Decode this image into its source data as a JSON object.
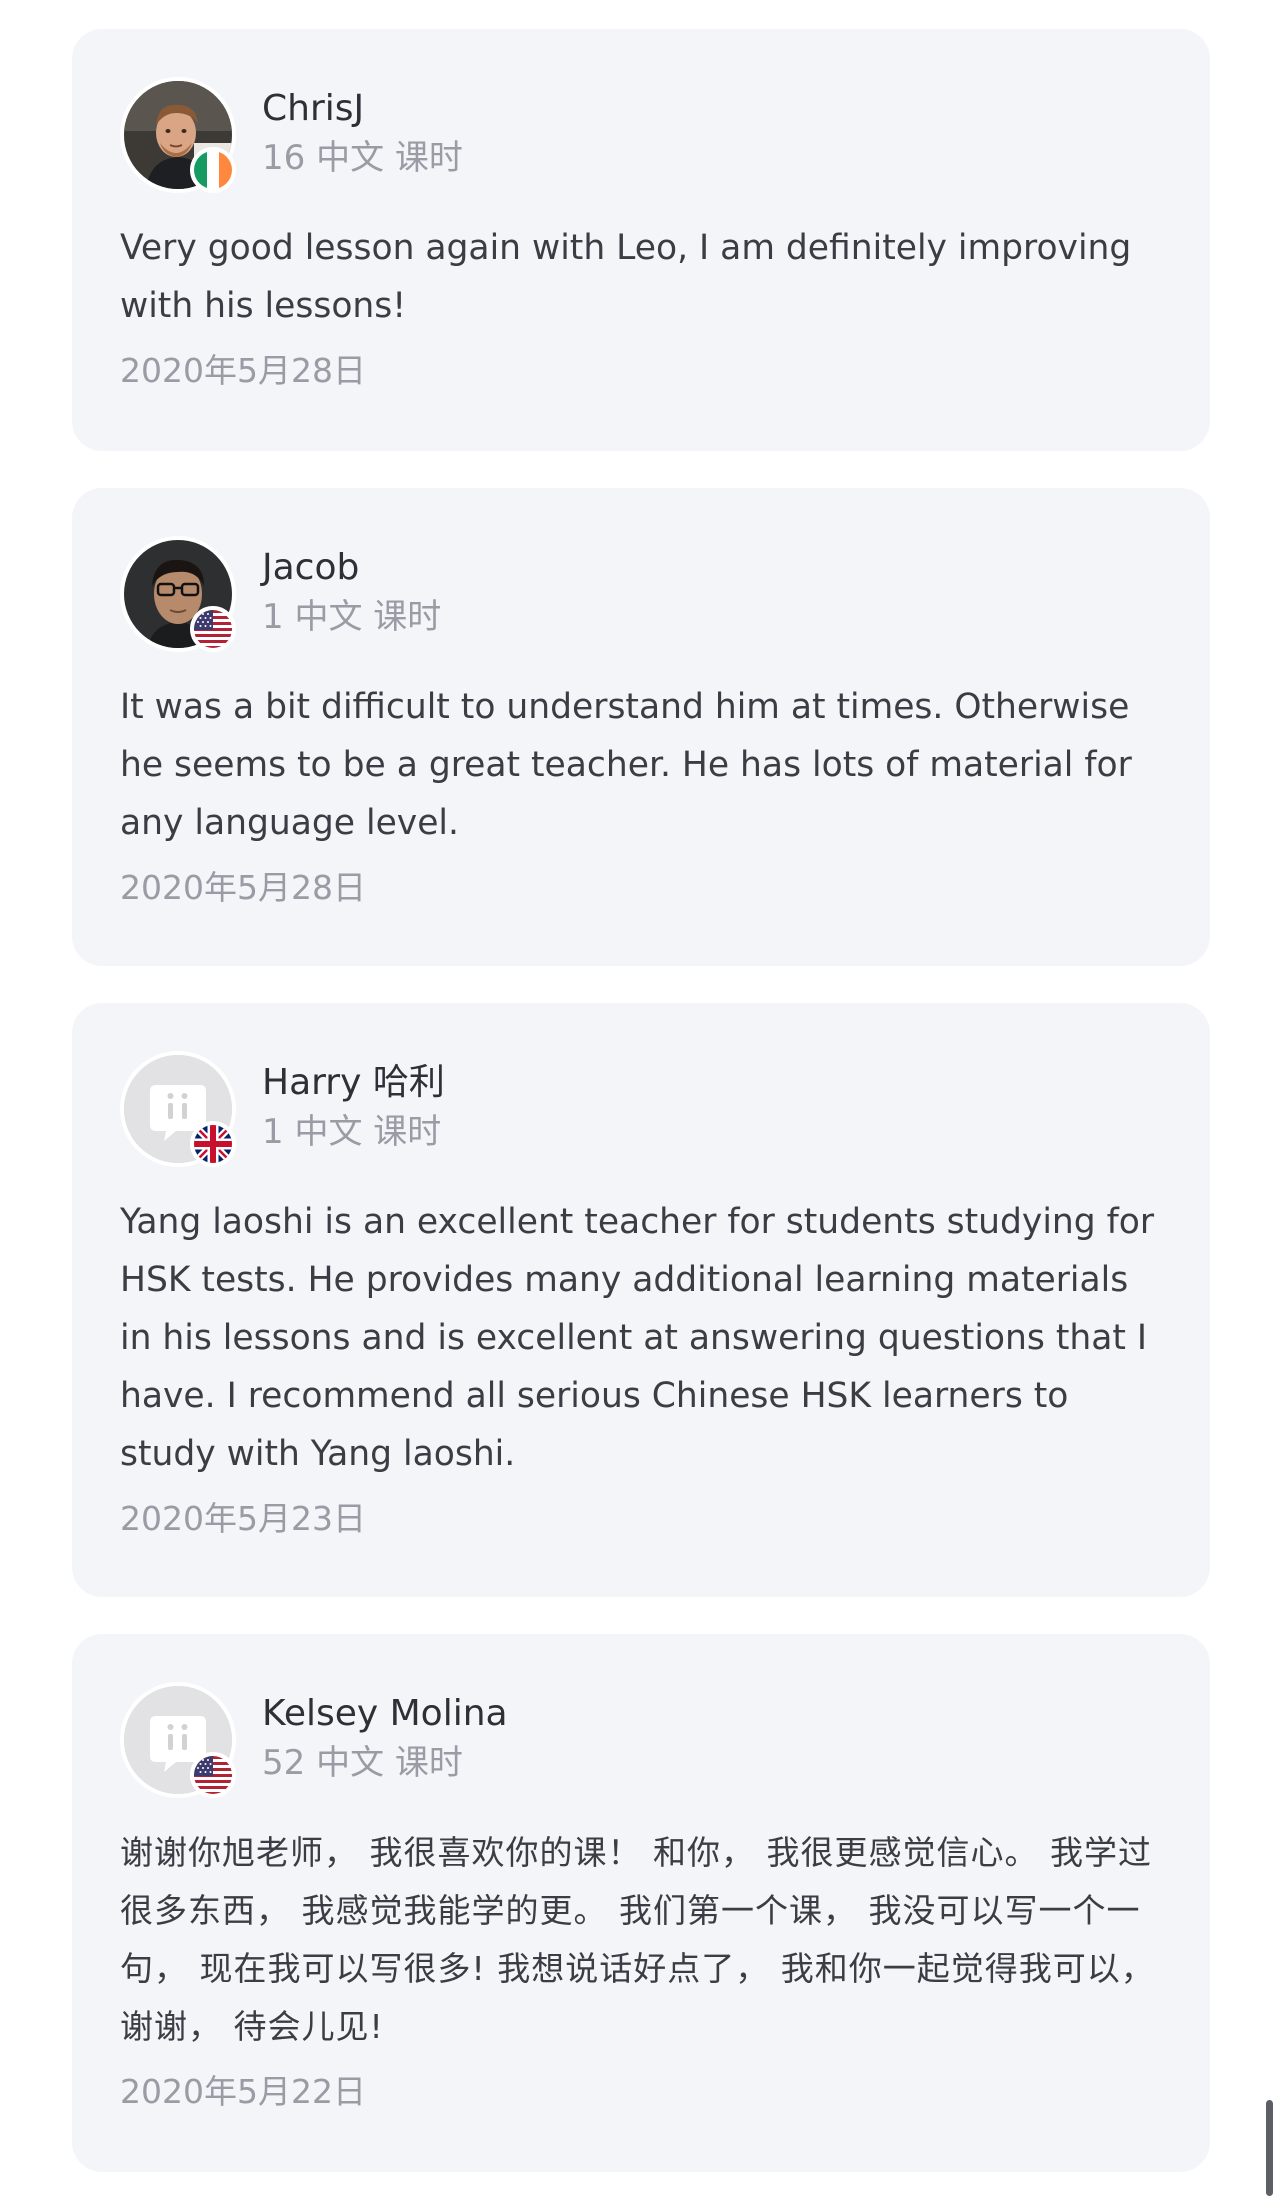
{
  "reviews": [
    {
      "name": "ChrisJ",
      "lessons": "16 中文 课时",
      "avatar": "photo-avatar-icon",
      "flag": "ireland-flag-icon",
      "text": "Very good lesson again with Leo, I am definitely improving with his lessons!",
      "date": "2020年5月28日"
    },
    {
      "name": "Jacob",
      "lessons": "1 中文 课时",
      "avatar": "photo-avatar-icon",
      "flag": "usa-flag-icon",
      "text": "It was a bit difficult to understand him at times. Otherwise he seems to be a great teacher. He has lots of material for any language level.",
      "date": "2020年5月28日"
    },
    {
      "name": "Harry 哈利",
      "lessons": "1 中文 课时",
      "avatar": "default-avatar-icon",
      "flag": "uk-flag-icon",
      "text": "Yang laoshi is an excellent teacher for students studying for HSK tests. He provides many additional learning materials in his lessons and is excellent at answering questions that I have. I recommend all serious Chinese HSK learners to study with Yang laoshi.",
      "date": "2020年5月23日"
    },
    {
      "name": "Kelsey Molina",
      "lessons": "52 中文 课时",
      "avatar": "default-avatar-icon",
      "flag": "usa-flag-icon",
      "text": "谢谢你旭老师， 我很喜欢你的课！ 和你， 我很更感觉信心。 我学过很多东西， 我感觉我能学的更。 我们第一个课， 我没可以写一个一句， 现在我可以写很多! 我想说话好点了， 我和你一起觉得我可以， 谢谢， 待会儿见!",
      "date": "2020年5月22日"
    }
  ],
  "colors": {
    "card_background": "#f4f5f9",
    "primary_text": "#3b3d45",
    "secondary_text": "#9a9ca5"
  }
}
